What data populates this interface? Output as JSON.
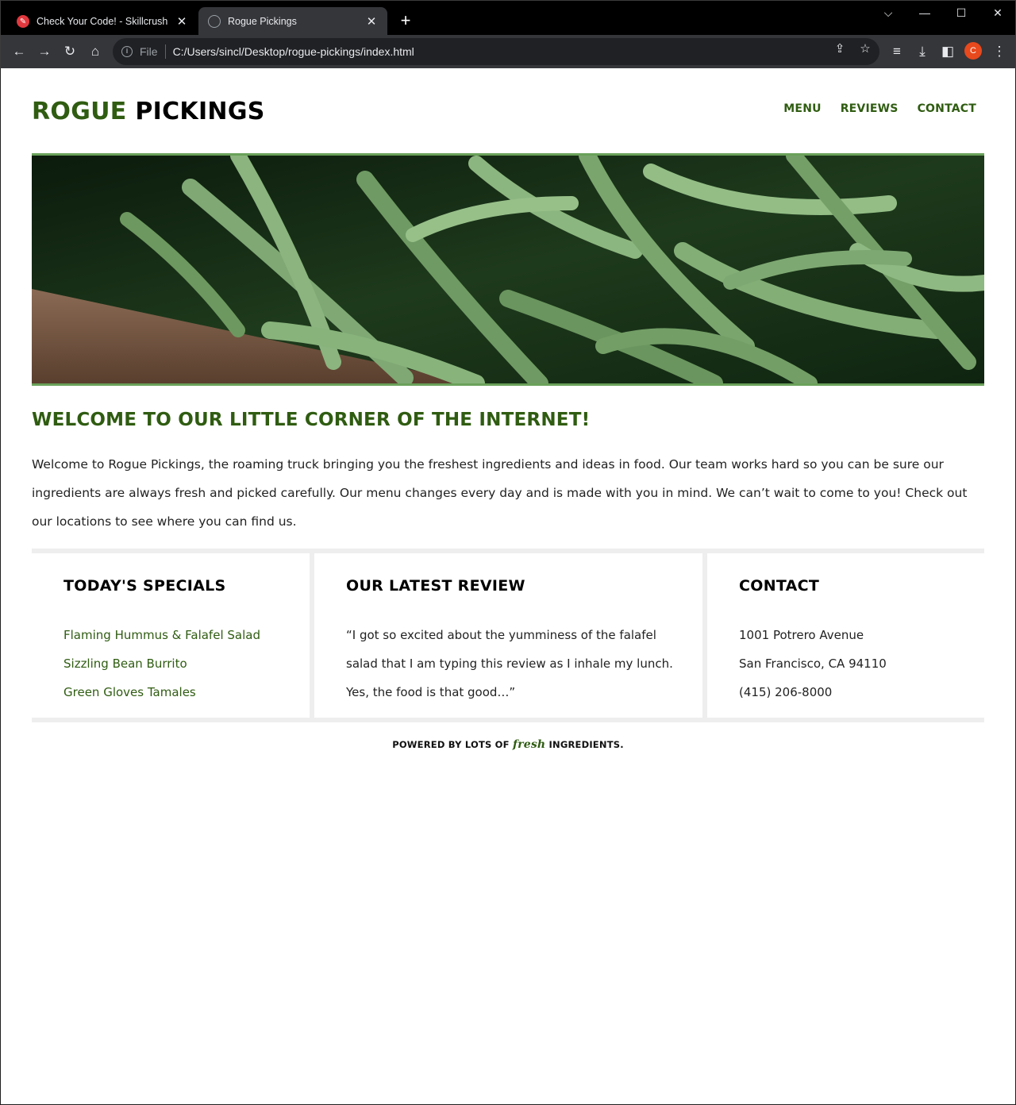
{
  "browser": {
    "tabs": [
      {
        "title": "Check Your Code! - Skillcrush",
        "active": false,
        "favicon": "skillcrush-icon"
      },
      {
        "title": "Rogue Pickings",
        "active": true,
        "favicon": "globe-icon"
      }
    ],
    "address": {
      "scheme_label": "File",
      "url": "C:/Users/sincl/Desktop/rogue-pickings/index.html"
    },
    "profile_initial": "C",
    "profile_color": "#e8491d"
  },
  "site": {
    "logo": {
      "part1": "ROGUE",
      "part2": "PICKINGS"
    },
    "nav": [
      "MENU",
      "REVIEWS",
      "CONTACT"
    ],
    "hero_image": "green-beans-photo",
    "welcome": {
      "title": "WELCOME TO OUR LITTLE CORNER OF THE INTERNET!",
      "text": "Welcome to Rogue Pickings, the roaming truck bringing you the freshest ingredients and ideas in food. Our team works hard so you can be sure our ingredients are always fresh and picked carefully. Our menu changes every day and is made with you in mind. We can’t wait to come to you! Check out our locations to see where you can find us."
    },
    "specials": {
      "title": "TODAY'S SPECIALS",
      "items": [
        "Flaming Hummus & Falafel Salad",
        "Sizzling Bean Burrito",
        "Green Gloves Tamales"
      ]
    },
    "review": {
      "title": "OUR LATEST REVIEW",
      "text": "“I got so excited about the yumminess of the falafel salad that I am typing this review as I inhale my lunch. Yes, the food is that good…”"
    },
    "contact": {
      "title": "CONTACT",
      "lines": [
        "1001 Potrero Avenue",
        "San Francisco, CA 94110",
        "(415) 206-8000"
      ]
    },
    "footer": {
      "before": "POWERED BY LOTS OF",
      "fresh": "fresh",
      "after": "INGREDIENTS."
    },
    "colors": {
      "brand_green": "#2f5c11",
      "border_green": "#6aa15a",
      "box_gray": "#eeeeee"
    }
  }
}
